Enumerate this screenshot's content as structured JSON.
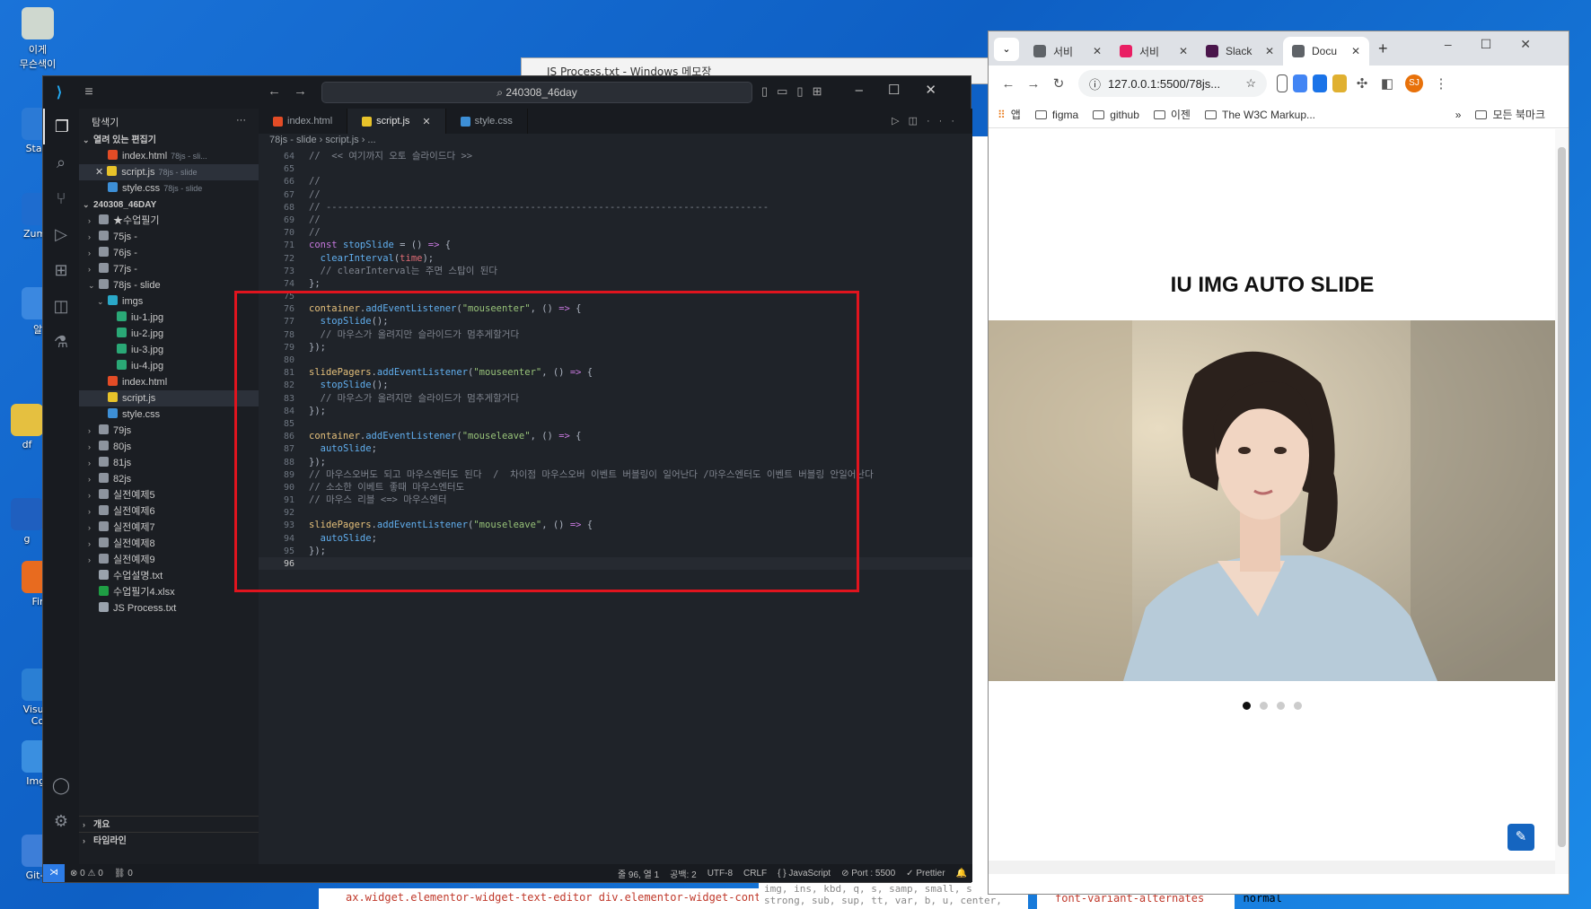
{
  "desktop": {
    "icons": [
      {
        "label": "이게\n무슨색이",
        "name": "desktop-icon-image"
      },
      {
        "label": "Start",
        "name": "desktop-icon-start"
      },
      {
        "label": "Zum I",
        "name": "desktop-icon-zum"
      },
      {
        "label": "알",
        "name": "desktop-icon-al"
      },
      {
        "label": "df",
        "name": "desktop-icon-df"
      },
      {
        "label": "g",
        "name": "desktop-icon-g"
      },
      {
        "label": "Fir",
        "name": "desktop-icon-firefox"
      },
      {
        "label": "Visual\nCo",
        "name": "desktop-icon-vscode"
      },
      {
        "label": "Imgr",
        "name": "desktop-icon-imgr"
      },
      {
        "label": "Git-2",
        "name": "desktop-icon-git"
      }
    ]
  },
  "notepad": {
    "title": "JS Process.txt - Windows 메모장"
  },
  "vscode": {
    "search": "240308_46day",
    "explorer_title": "탐색기",
    "open_editors_label": "열려 있는 편집기",
    "open_editors": [
      {
        "name": "index.html",
        "path": "78js - sli...",
        "type": "html"
      },
      {
        "name": "script.js",
        "path": "78js - slide",
        "type": "js"
      },
      {
        "name": "style.css",
        "path": "78js - slide",
        "type": "css"
      }
    ],
    "workspace_label": "240308_46DAY",
    "tree": [
      {
        "label": "★수업필기",
        "indent": 1,
        "kind": "folder",
        "chev": "›"
      },
      {
        "label": "75js -",
        "indent": 1,
        "kind": "folder",
        "chev": "›"
      },
      {
        "label": "76js -",
        "indent": 1,
        "kind": "folder",
        "chev": "›"
      },
      {
        "label": "77js -",
        "indent": 1,
        "kind": "folder",
        "chev": "›"
      },
      {
        "label": "78js - slide",
        "indent": 1,
        "kind": "folder",
        "chev": "⌄"
      },
      {
        "label": "imgs",
        "indent": 2,
        "kind": "folder img-f",
        "chev": "⌄"
      },
      {
        "label": "iu-1.jpg",
        "indent": 3,
        "kind": "img",
        "chev": ""
      },
      {
        "label": "iu-2.jpg",
        "indent": 3,
        "kind": "img",
        "chev": ""
      },
      {
        "label": "iu-3.jpg",
        "indent": 3,
        "kind": "img",
        "chev": ""
      },
      {
        "label": "iu-4.jpg",
        "indent": 3,
        "kind": "img",
        "chev": ""
      },
      {
        "label": "index.html",
        "indent": 2,
        "kind": "html",
        "chev": ""
      },
      {
        "label": "script.js",
        "indent": 2,
        "kind": "js",
        "chev": "",
        "selected": true
      },
      {
        "label": "style.css",
        "indent": 2,
        "kind": "css",
        "chev": ""
      },
      {
        "label": "79js",
        "indent": 1,
        "kind": "folder",
        "chev": "›"
      },
      {
        "label": "80js",
        "indent": 1,
        "kind": "folder",
        "chev": "›"
      },
      {
        "label": "81js",
        "indent": 1,
        "kind": "folder",
        "chev": "›"
      },
      {
        "label": "82js",
        "indent": 1,
        "kind": "folder",
        "chev": "›"
      },
      {
        "label": "실전예제5",
        "indent": 1,
        "kind": "folder",
        "chev": "›"
      },
      {
        "label": "실전예제6",
        "indent": 1,
        "kind": "folder",
        "chev": "›"
      },
      {
        "label": "실전예제7",
        "indent": 1,
        "kind": "folder",
        "chev": "›"
      },
      {
        "label": "실전예제8",
        "indent": 1,
        "kind": "folder",
        "chev": "›"
      },
      {
        "label": "실전예제9",
        "indent": 1,
        "kind": "folder",
        "chev": "›"
      },
      {
        "label": "수업설명.txt",
        "indent": 1,
        "kind": "txt",
        "chev": ""
      },
      {
        "label": "수업필기4.xlsx",
        "indent": 1,
        "kind": "xls",
        "chev": ""
      },
      {
        "label": "JS Process.txt",
        "indent": 1,
        "kind": "txt",
        "chev": ""
      }
    ],
    "outline_label": "개요",
    "timeline_label": "타임라인",
    "tabs": [
      {
        "label": "index.html",
        "type": "html",
        "active": false
      },
      {
        "label": "script.js",
        "type": "js",
        "active": true
      },
      {
        "label": "style.css",
        "type": "css",
        "active": false
      }
    ],
    "breadcrumb": "78js - slide  ›  script.js  ›  ...",
    "code": [
      {
        "n": "64",
        "tokens": [
          [
            "t-cm",
            "//  << 여기까지 오토 슬라이드다 >>"
          ]
        ]
      },
      {
        "n": "65",
        "tokens": []
      },
      {
        "n": "66",
        "tokens": [
          [
            "t-cm",
            "//"
          ]
        ]
      },
      {
        "n": "67",
        "tokens": [
          [
            "t-cm",
            "//"
          ]
        ]
      },
      {
        "n": "68",
        "tokens": [
          [
            "t-cm",
            "// ------------------------------------------------------------------------------"
          ]
        ]
      },
      {
        "n": "69",
        "tokens": [
          [
            "t-cm",
            "//"
          ]
        ]
      },
      {
        "n": "70",
        "tokens": [
          [
            "t-cm",
            "//"
          ]
        ]
      },
      {
        "n": "71",
        "tokens": [
          [
            "t-kw",
            "const "
          ],
          [
            "t-fn",
            "stopSlide"
          ],
          [
            "t-pun",
            " = () "
          ],
          [
            "t-kw",
            "=>"
          ],
          [
            "t-pun",
            " {"
          ]
        ]
      },
      {
        "n": "72",
        "tokens": [
          [
            "t-plain",
            "  "
          ],
          [
            "t-fn",
            "clearInterval"
          ],
          [
            "t-pun",
            "("
          ],
          [
            "t-id",
            "time"
          ],
          [
            "t-pun",
            ");"
          ]
        ]
      },
      {
        "n": "73",
        "tokens": [
          [
            "t-plain",
            "  "
          ],
          [
            "t-cm",
            "// clearInterval는 주면 스탑이 된다"
          ]
        ]
      },
      {
        "n": "74",
        "tokens": [
          [
            "t-pun",
            "};"
          ]
        ]
      },
      {
        "n": "75",
        "tokens": []
      },
      {
        "n": "76",
        "tokens": [
          [
            "t-var",
            "container"
          ],
          [
            "t-pun",
            "."
          ],
          [
            "t-fn",
            "addEventListener"
          ],
          [
            "t-pun",
            "("
          ],
          [
            "t-str",
            "\"mouseenter\""
          ],
          [
            "t-pun",
            ", () "
          ],
          [
            "t-kw",
            "=>"
          ],
          [
            "t-pun",
            " {"
          ]
        ]
      },
      {
        "n": "77",
        "tokens": [
          [
            "t-plain",
            "  "
          ],
          [
            "t-fn",
            "stopSlide"
          ],
          [
            "t-pun",
            "();"
          ]
        ]
      },
      {
        "n": "78",
        "tokens": [
          [
            "t-plain",
            "  "
          ],
          [
            "t-cm",
            "// 마우스가 올려지만 슬라이드가 멈추게할거다"
          ]
        ]
      },
      {
        "n": "79",
        "tokens": [
          [
            "t-pun",
            "});"
          ]
        ]
      },
      {
        "n": "80",
        "tokens": []
      },
      {
        "n": "81",
        "tokens": [
          [
            "t-var",
            "slidePagers"
          ],
          [
            "t-pun",
            "."
          ],
          [
            "t-fn",
            "addEventListener"
          ],
          [
            "t-pun",
            "("
          ],
          [
            "t-str",
            "\"mouseenter\""
          ],
          [
            "t-pun",
            ", () "
          ],
          [
            "t-kw",
            "=>"
          ],
          [
            "t-pun",
            " {"
          ]
        ]
      },
      {
        "n": "82",
        "tokens": [
          [
            "t-plain",
            "  "
          ],
          [
            "t-fn",
            "stopSlide"
          ],
          [
            "t-pun",
            "();"
          ]
        ]
      },
      {
        "n": "83",
        "tokens": [
          [
            "t-plain",
            "  "
          ],
          [
            "t-cm",
            "// 마우스가 올려지만 슬라이드가 멈추게할거다"
          ]
        ]
      },
      {
        "n": "84",
        "tokens": [
          [
            "t-pun",
            "});"
          ]
        ]
      },
      {
        "n": "85",
        "tokens": []
      },
      {
        "n": "86",
        "tokens": [
          [
            "t-var",
            "container"
          ],
          [
            "t-pun",
            "."
          ],
          [
            "t-fn",
            "addEventListener"
          ],
          [
            "t-pun",
            "("
          ],
          [
            "t-str",
            "\"mouseleave\""
          ],
          [
            "t-pun",
            ", () "
          ],
          [
            "t-kw",
            "=>"
          ],
          [
            "t-pun",
            " {"
          ]
        ]
      },
      {
        "n": "87",
        "tokens": [
          [
            "t-plain",
            "  "
          ],
          [
            "t-fn",
            "autoSlide"
          ],
          [
            "t-pun",
            ";"
          ]
        ]
      },
      {
        "n": "88",
        "tokens": [
          [
            "t-pun",
            "});"
          ]
        ]
      },
      {
        "n": "89",
        "tokens": [
          [
            "t-cm",
            "// 마우스오버도 되고 마우스엔터도 된다  /  차이점 마우스오버 이벤트 버블링이 일어난다 /마우스엔터도 이벤트 버블링 안일어난다"
          ]
        ]
      },
      {
        "n": "90",
        "tokens": [
          [
            "t-cm",
            "// 소소한 이베트 좋때 마우스엔터도"
          ]
        ]
      },
      {
        "n": "91",
        "tokens": [
          [
            "t-cm",
            "// 마우스 리블 <=> 마우스엔터"
          ]
        ]
      },
      {
        "n": "92",
        "tokens": []
      },
      {
        "n": "93",
        "tokens": [
          [
            "t-var",
            "slidePagers"
          ],
          [
            "t-pun",
            "."
          ],
          [
            "t-fn",
            "addEventListener"
          ],
          [
            "t-pun",
            "("
          ],
          [
            "t-str",
            "\"mouseleave\""
          ],
          [
            "t-pun",
            ", () "
          ],
          [
            "t-kw",
            "=>"
          ],
          [
            "t-pun",
            " {"
          ]
        ]
      },
      {
        "n": "94",
        "tokens": [
          [
            "t-plain",
            "  "
          ],
          [
            "t-fn",
            "autoSlide"
          ],
          [
            "t-pun",
            ";"
          ]
        ]
      },
      {
        "n": "95",
        "tokens": [
          [
            "t-pun",
            "});"
          ]
        ]
      },
      {
        "n": "96",
        "tokens": [],
        "current": true
      }
    ],
    "status": {
      "errors": "⊗ 0 ⚠ 0",
      "ports": "⛓ 0",
      "position": "줄 96, 열 1",
      "spaces": "공백: 2",
      "encoding": "UTF-8",
      "eol": "CRLF",
      "language": "{ } JavaScript",
      "port": "⊘ Port : 5500",
      "prettier": "✓ Prettier"
    }
  },
  "chrome": {
    "tabs": [
      {
        "label": "서비",
        "color": "#5f6368",
        "active": false
      },
      {
        "label": "서비",
        "color": "#e91e63",
        "active": false
      },
      {
        "label": "Slack",
        "color": "#4a154b",
        "active": false
      },
      {
        "label": "Docu",
        "color": "#5f6368",
        "active": true
      }
    ],
    "url": "127.0.0.1:5500/78js...",
    "bookmarks": [
      "앱",
      "figma",
      "github",
      "이젠",
      "The W3C Markup..."
    ],
    "all_bookmarks": "모든 북마크",
    "avatar": "SJ",
    "page": {
      "title": "IU IMG AUTO SLIDE",
      "dots": 4,
      "active_dot": 0
    }
  },
  "devtools": {
    "bottom_selector": "ax.widget.elementor-widget-text-editor   div.elementor-widget-container",
    "bottom_css": "img, ins, kbd, q, s, samp, small, s\nstrong, sub, sup, tt, var, b, u, center,",
    "bottom_prop": "font-variant-alternates",
    "bottom_value": "normal"
  }
}
